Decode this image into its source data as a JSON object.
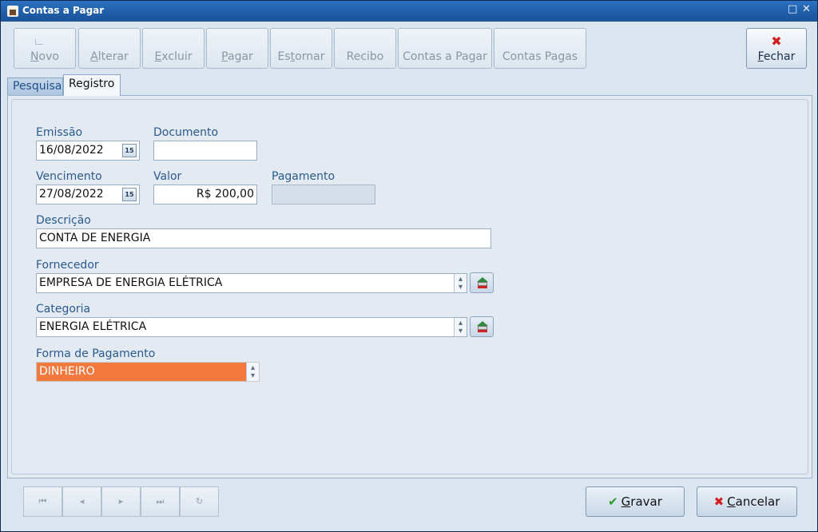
{
  "window": {
    "title": "Contas a Pagar",
    "controls": [
      "□",
      "✕"
    ]
  },
  "toolbar": {
    "novo": {
      "key": "N",
      "rest": "ovo"
    },
    "alterar": {
      "key": "A",
      "rest": "lterar"
    },
    "excluir": {
      "key": "E",
      "rest": "xcluir"
    },
    "pagar": {
      "key": "P",
      "rest": "agar"
    },
    "estornar": {
      "pre": "Es",
      "key": "t",
      "rest": "ornar"
    },
    "recibo": "Recibo",
    "contas_a_pagar": "Contas a Pagar",
    "contas_pagas": "Contas Pagas",
    "fechar": {
      "key": "F",
      "rest": "echar"
    }
  },
  "tabs": [
    {
      "label": "Pesquisa"
    },
    {
      "label": "Registro"
    }
  ],
  "form": {
    "emissao": {
      "label": "Emissão",
      "value": "16/08/2022"
    },
    "documento": {
      "label": "Documento",
      "value": ""
    },
    "vencimento": {
      "label": "Vencimento",
      "value": "27/08/2022"
    },
    "valor": {
      "label": "Valor",
      "value": "R$ 200,00"
    },
    "pagamento": {
      "label": "Pagamento",
      "value": ""
    },
    "descricao": {
      "label": "Descrição",
      "value": "CONTA DE ENERGIA"
    },
    "fornecedor": {
      "label": "Fornecedor",
      "value": "EMPRESA DE ENERGIA ELÉTRICA"
    },
    "categoria": {
      "label": "Categoria",
      "value": "ENERGIA ELÉTRICA"
    },
    "forma_pagamento": {
      "label": "Forma de Pagamento",
      "value": "DINHEIRO"
    },
    "calendar_glyph": "15"
  },
  "nav": {
    "first": "⏮",
    "prev": "◂",
    "next": "▸",
    "last": "⏭",
    "refresh": "↻"
  },
  "actions": {
    "gravar": {
      "key": "G",
      "rest": "ravar"
    },
    "cancelar": {
      "key": "C",
      "rest": "ancelar"
    }
  },
  "colors": {
    "accent": "#1f5ea9",
    "selected_field": "#f3793f"
  }
}
